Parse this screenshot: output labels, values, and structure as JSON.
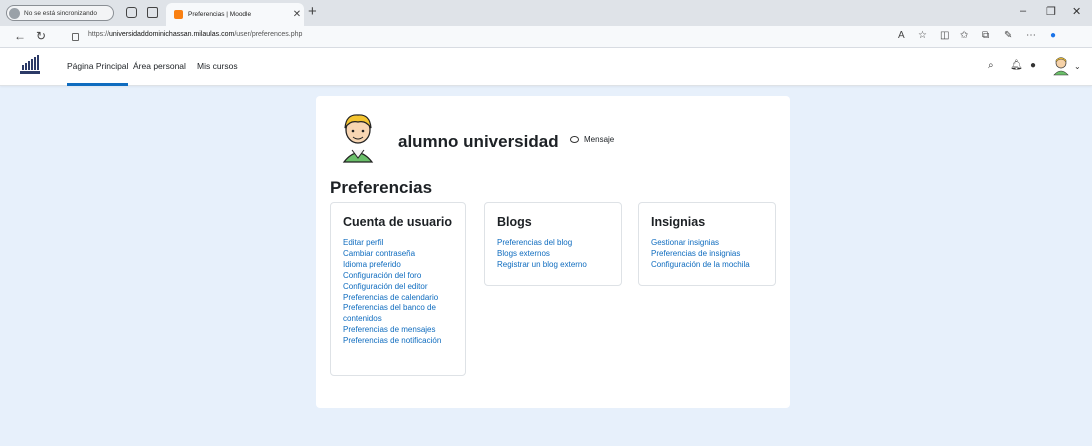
{
  "browser": {
    "sync_label": "No se está sincronizando",
    "tab_title": "Preferencias | Moodle",
    "url_prefix": "https://",
    "url_domain": "universidaddominichassan.milaulas.com",
    "url_path": "/user/preferences.php"
  },
  "navbar": {
    "links": [
      "Página Principal",
      "Área personal",
      "Mis cursos"
    ],
    "active_index": 0
  },
  "profile": {
    "name": "alumno universidad",
    "message_label": "Mensaje"
  },
  "page": {
    "heading": "Preferencias"
  },
  "sections": [
    {
      "title": "Cuenta de usuario",
      "links": [
        "Editar perfil",
        "Cambiar contraseña",
        "Idioma preferido",
        "Configuración del foro",
        "Configuración del editor",
        "Preferencias de calendario",
        "Preferencias del banco de contenidos",
        "Preferencias de mensajes",
        "Preferencias de notificación"
      ]
    },
    {
      "title": "Blogs",
      "links": [
        "Preferencias del blog",
        "Blogs externos",
        "Registrar un blog externo"
      ]
    },
    {
      "title": "Insignias",
      "links": [
        "Gestionar insignias",
        "Preferencias de insignias",
        "Configuración de la mochila"
      ]
    }
  ],
  "colors": {
    "page_bg": "#e7f0fb",
    "link": "#0f6cbf",
    "brand_accent": "#f98012"
  }
}
